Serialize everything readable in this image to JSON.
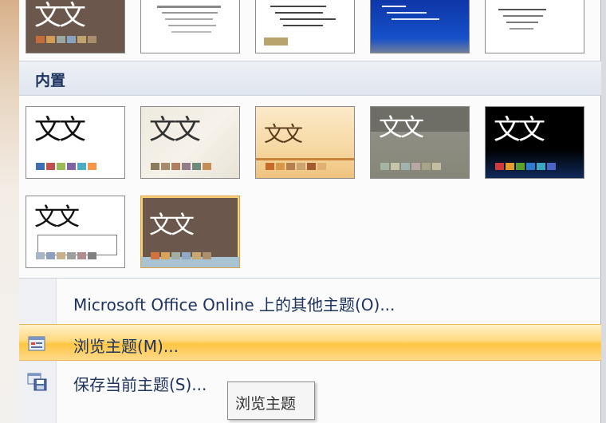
{
  "section": {
    "title": "内置"
  },
  "theme_sample_text": "文文",
  "menu": {
    "online_themes": "Microsoft Office Online 上的其他主题(O)...",
    "browse_themes": "浏览主题(M)...",
    "save_theme": "保存当前主题(S)..."
  },
  "tooltip": {
    "text": "浏览主题"
  },
  "colors": {
    "header_text": "#1e3460",
    "highlight": "#ffd97f"
  }
}
